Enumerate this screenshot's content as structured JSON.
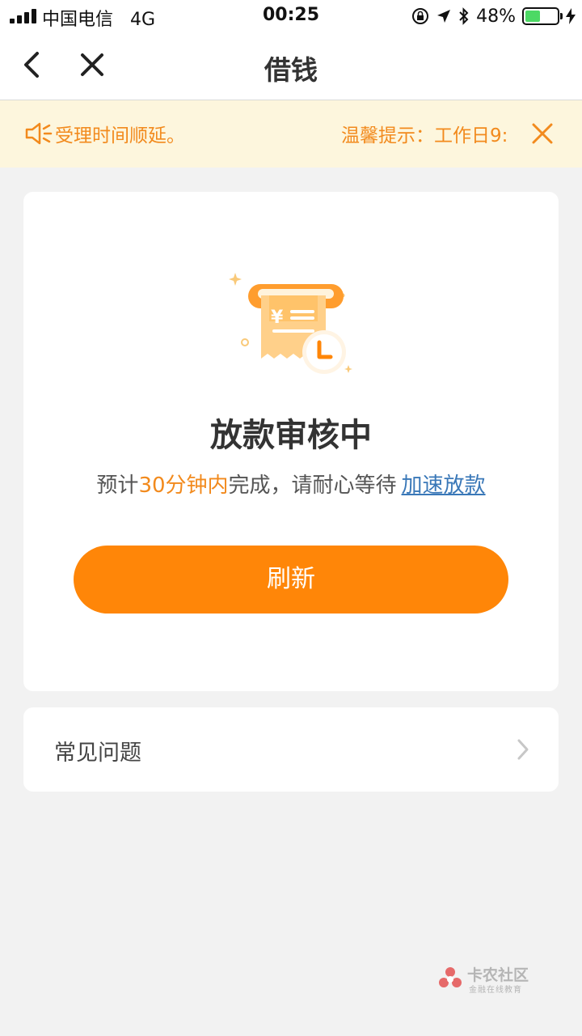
{
  "status_bar": {
    "carrier": "中国电信",
    "network": "4G",
    "time": "00:25",
    "battery_percent": "48%",
    "battery_level": 0.48
  },
  "nav": {
    "title": "借钱"
  },
  "notice": {
    "text": "受理时间顺延。",
    "tip": "温馨提示：工作日9:"
  },
  "status_card": {
    "title": "放款审核中",
    "desc_prefix": "预计",
    "desc_highlight": "30分钟内",
    "desc_suffix": "完成，请耐心等待",
    "link_label": "加速放款",
    "refresh_label": "刷新"
  },
  "faq": {
    "label": "常见问题"
  },
  "watermark": {
    "name": "卡农社区",
    "sub": "金融在线教育"
  },
  "colors": {
    "accent": "#ff8608",
    "notice_text": "#f28a1d",
    "notice_bg": "#fdf6dd",
    "link": "#3a78b8"
  }
}
